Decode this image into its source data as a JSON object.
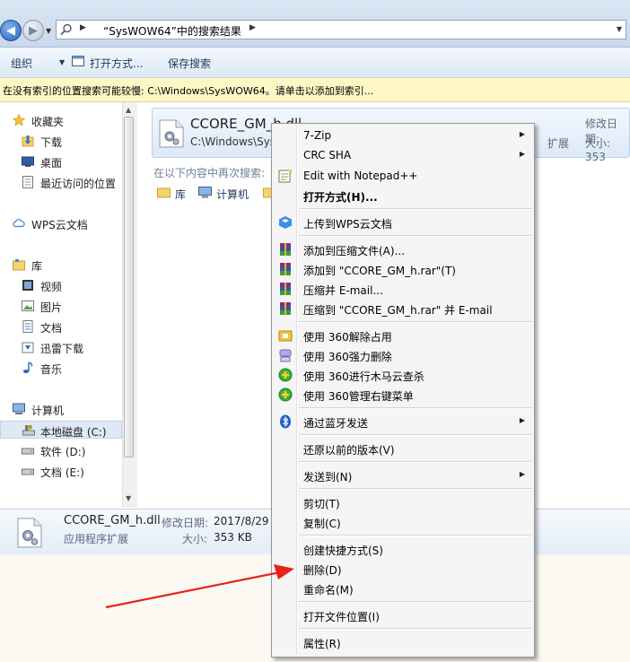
{
  "address_bar": {
    "path_text": "“SysWOW64”中的搜索结果"
  },
  "toolbar": {
    "organize": "组织",
    "open_with": "打开方式...",
    "save_search": "保存搜索"
  },
  "info_bar": {
    "text": "在没有索引的位置搜索可能较慢: C:\\Windows\\SysWOW64。请单击以添加到索引..."
  },
  "nav": {
    "favorites": "收藏夹",
    "downloads": "下载",
    "desktop": "桌面",
    "recent": "最近访问的位置",
    "wps_cloud": "WPS云文档",
    "libraries": "库",
    "videos": "视频",
    "pictures": "图片",
    "documents": "文档",
    "xunlei": "迅雷下载",
    "music": "音乐",
    "computer": "计算机",
    "local_c": "本地磁盘 (C:)",
    "soft_d": "软件 (D:)",
    "docs_e": "文档 (E:)"
  },
  "result": {
    "name": "CCORE_GM_h.dll",
    "path": "C:\\Windows\\Sys",
    "date_label": "修改日期:",
    "type_partial": "扩展",
    "size_label": "大小: 353"
  },
  "search_again": {
    "label": "在以下内容中再次搜索:",
    "library": "库",
    "computer": "计算机"
  },
  "details": {
    "name": "CCORE_GM_h.dll",
    "date_label": "修改日期:",
    "date_value": "2017/8/29",
    "type": "应用程序扩展",
    "size_label": "大小:",
    "size_value": "353 KB"
  },
  "context_menu": {
    "items": [
      {
        "label": "7-Zip",
        "submenu": true
      },
      {
        "label": "CRC SHA",
        "submenu": true
      },
      {
        "label": "Edit with Notepad++",
        "icon": "notepad-plus-icon"
      },
      {
        "label": "打开方式(H)...",
        "bold": true
      },
      {
        "label": "上传到WPS云文档",
        "icon": "wps-cloud-icon"
      },
      {
        "label": "添加到压缩文件(A)...",
        "icon": "winrar-icon"
      },
      {
        "label": "添加到 \"CCORE_GM_h.rar\"(T)",
        "icon": "winrar-icon"
      },
      {
        "label": "压缩并 E-mail...",
        "icon": "winrar-icon"
      },
      {
        "label": "压缩到 \"CCORE_GM_h.rar\" 并 E-mail",
        "icon": "winrar-icon"
      },
      {
        "label": "使用 360解除占用",
        "icon": "unlock-360-icon"
      },
      {
        "label": "使用 360强力删除",
        "icon": "shred-360-icon"
      },
      {
        "label": "使用 360进行木马云查杀",
        "icon": "scan-360-icon"
      },
      {
        "label": "使用 360管理右键菜单",
        "icon": "scan-360-icon"
      },
      {
        "label": "通过蓝牙发送",
        "icon": "bluetooth-icon",
        "submenu": true
      },
      {
        "label": "还原以前的版本(V)"
      },
      {
        "label": "发送到(N)",
        "submenu": true
      },
      {
        "label": "剪切(T)"
      },
      {
        "label": "复制(C)"
      },
      {
        "label": "创建快捷方式(S)"
      },
      {
        "label": "删除(D)"
      },
      {
        "label": "重命名(M)"
      },
      {
        "label": "打开文件位置(I)"
      },
      {
        "label": "属性(R)"
      }
    ]
  },
  "colors": {
    "menu_bg": "#f5f5f5",
    "selection_bg": "#dde9f7",
    "info_bar_bg": "#fdf6c5",
    "annotation_arrow": "#e8231c"
  }
}
